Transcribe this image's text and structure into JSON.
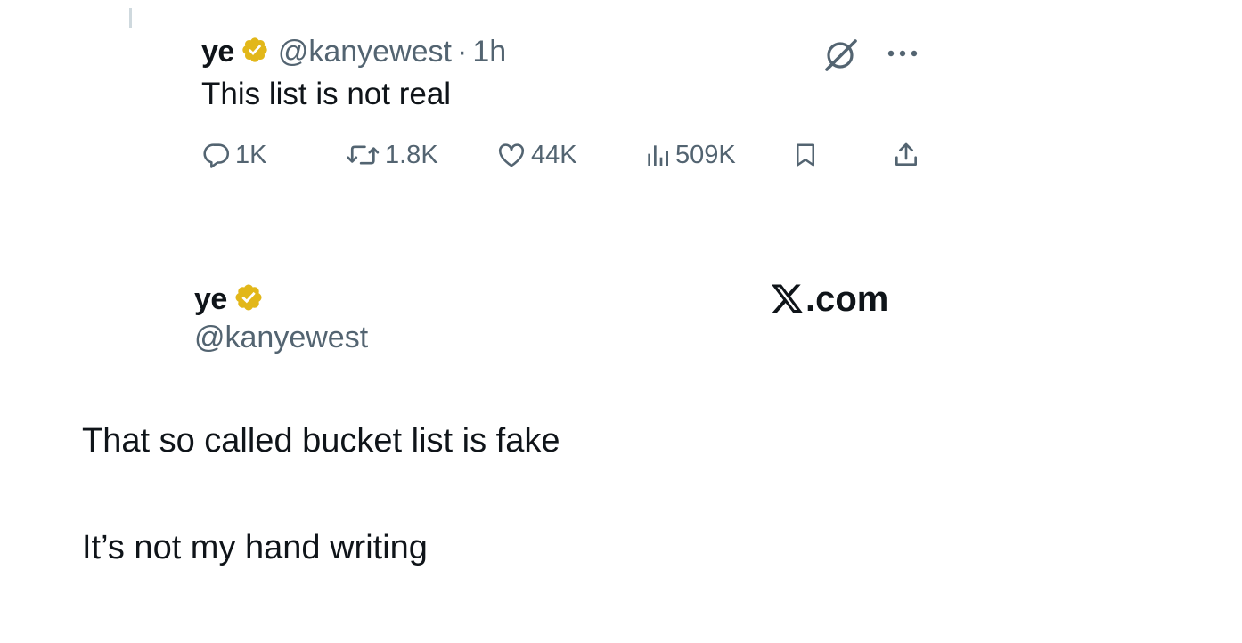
{
  "tweet1": {
    "display_name": "ye",
    "handle": "@kanyewest",
    "separator": "·",
    "time": "1h",
    "text": "This list is not real",
    "actions": {
      "replies": "1K",
      "reposts": "1.8K",
      "likes": "44K",
      "views": "509K"
    },
    "icons": {
      "verified": "verified-badge-icon",
      "grok": "grok-icon",
      "more": "more-icon",
      "reply": "reply-icon",
      "repost": "repost-icon",
      "like": "heart-icon",
      "views": "views-chart-icon",
      "bookmark": "bookmark-icon",
      "share": "share-icon"
    }
  },
  "card": {
    "display_name": "ye",
    "handle": "@kanyewest",
    "brand_suffix": ".com",
    "lines": [
      "That so called bucket list is fake",
      "It’s not my hand writing"
    ]
  },
  "colors": {
    "text": "#0f1419",
    "muted": "#536471",
    "verified_gold": "#e2b719",
    "thread_line": "#cfd9de"
  }
}
